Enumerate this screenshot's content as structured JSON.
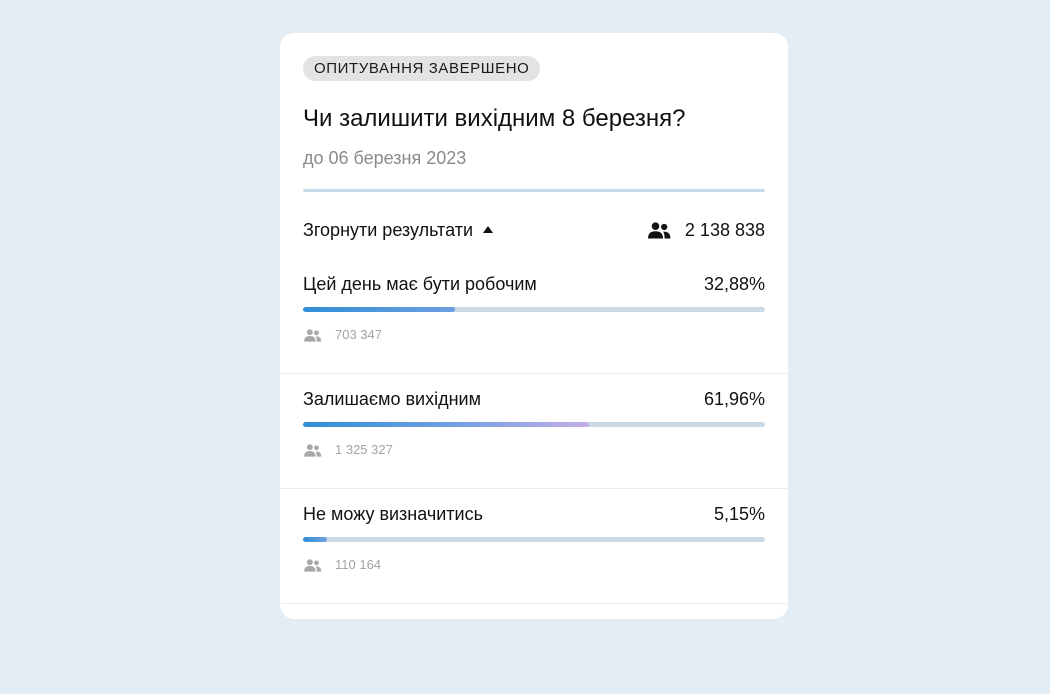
{
  "poll": {
    "status_badge": "ОПИТУВАННЯ ЗАВЕРШЕНО",
    "question": "Чи залишити вихідним 8 березня?",
    "deadline": "до 06 березня 2023",
    "collapse_label": "Згорнути результати",
    "total_voters": "2 138 838",
    "options": [
      {
        "label": "Цей день має бути робочим",
        "percent": "32,88%",
        "share": 32.88,
        "votes": "703 347"
      },
      {
        "label": "Залишаємо вихідним",
        "percent": "61,96%",
        "share": 61.96,
        "votes": "1 325 327"
      },
      {
        "label": "Не можу визначитись",
        "percent": "5,15%",
        "share": 5.15,
        "votes": "110 164"
      }
    ]
  },
  "colors": {
    "page_background": "#e4ecf4",
    "card_background": "#ffffff",
    "badge_background": "#e3e3e3",
    "bar_track": "#c9d9e6",
    "bar_fill_start": "#2f8fd6",
    "bar_fill_mid": "#6e9fe0",
    "bar_fill_end": "#c3aee8",
    "muted_text": "#8a8a8a"
  },
  "icons": {
    "total_voters": "people-icon",
    "option_votes": "people-icon",
    "collapse": "caret-up-icon"
  }
}
